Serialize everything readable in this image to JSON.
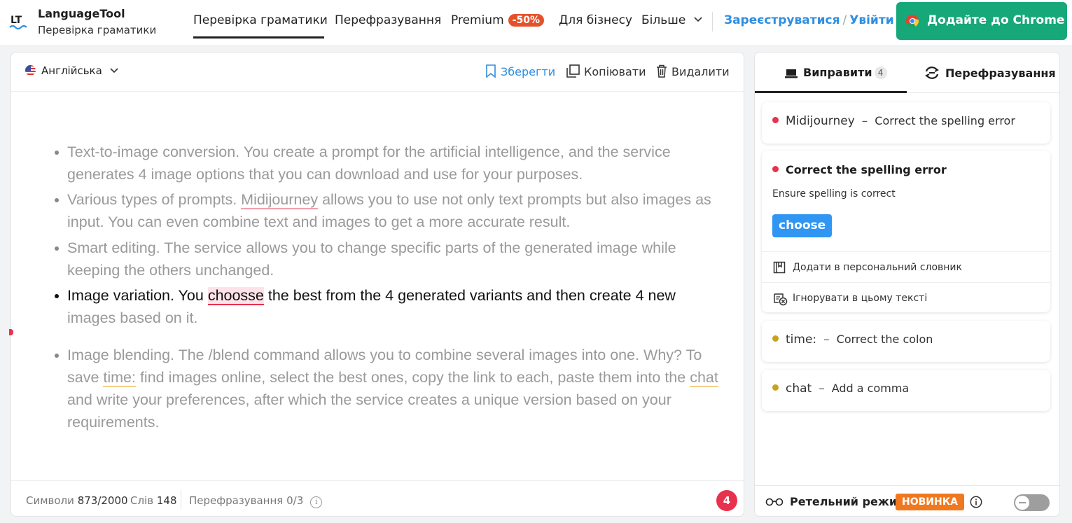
{
  "app": {
    "name": "LanguageTool",
    "subtitle": "Перевірка граматики"
  },
  "nav": {
    "items": [
      "Перевірка граматики",
      "Перефразування",
      "Premium",
      "Для бізнесу",
      "Більше"
    ],
    "sale_badge": "-50%",
    "signup": "Зареєструватися",
    "login": "Увійти",
    "chrome_button": "Додайте до Chrome"
  },
  "editor": {
    "language": "Англійська",
    "toolbar": {
      "save": "Зберегти",
      "copy": "Копіювати",
      "delete": "Видалити"
    },
    "bullets": [
      {
        "text": "Text-to-image conversion. You create a prompt for the artificial intelligence, and the service generates 4 image options that you can download and use for your purposes."
      },
      {
        "before": "Various types of prompts. ",
        "error": "Midijourney",
        "after": " allows you to use not only text prompts but also images as input. You can even combine text and images to get a more accurate result."
      },
      {
        "text": "Smart editing. The service allows you to change specific parts of the generated image while keeping the others unchanged."
      },
      {
        "line1_before": "Image variation. You ",
        "error": "choosse",
        "line1_after": " the best from the 4 generated variants and then create 4 new",
        "line2": "images based on it."
      },
      {
        "before": "Image blending. The /blend command allows you to combine several images into one. Why? To save ",
        "error1": "time:",
        "mid": " find images online, select the best ones, copy the link to each, paste them into the ",
        "error2": "chat",
        "after": " and write your preferences, after which the service creates a unique version based on your requirements."
      }
    ],
    "footer": {
      "chars_label": "Символи",
      "chars_value": "873/2000",
      "words_label": "Слів",
      "words_value": "148",
      "rephrase_label": "Перефразування",
      "rephrase_value": "0/3",
      "issues_count": "4"
    }
  },
  "panel": {
    "tabs": {
      "correct": "Виправити",
      "correct_count": "4",
      "rephrase": "Перефразування"
    },
    "issues": [
      {
        "word": "Midijourney",
        "desc": "Correct the spelling error",
        "color": "#e8314c"
      },
      {
        "word": "time:",
        "desc": "Correct the colon",
        "color": "#c9a21a"
      },
      {
        "word": "chat",
        "desc": "Add a comma",
        "color": "#c9a21a"
      }
    ],
    "expanded": {
      "title": "Correct the spelling error",
      "subtitle": "Ensure spelling is correct",
      "suggestion": "choose",
      "add_dict": "Додати в персональний словник",
      "ignore": "Ігнорувати в цьому тексті"
    },
    "footer": {
      "mode": "Ретельний режим",
      "new_badge": "НОВИНКА"
    }
  }
}
